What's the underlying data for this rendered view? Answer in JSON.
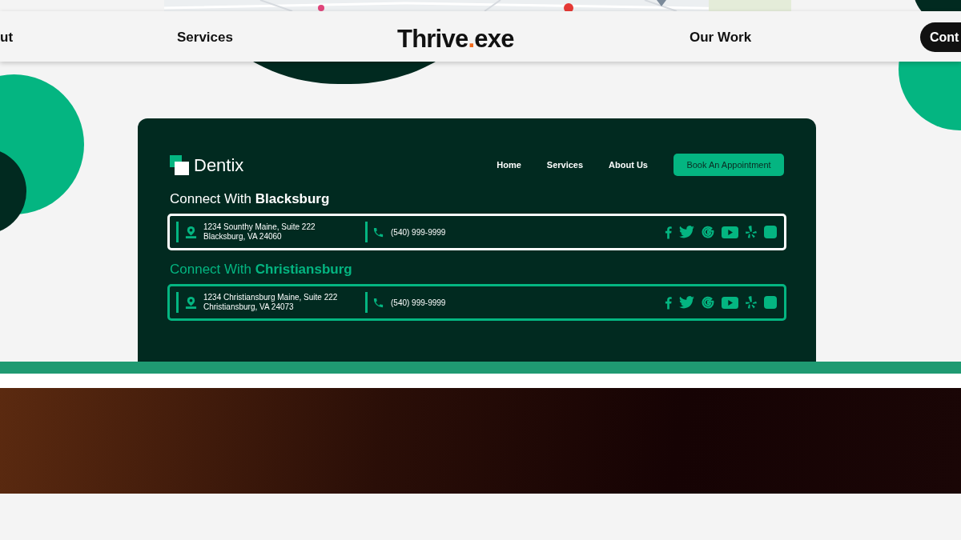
{
  "header": {
    "nav_left": [
      {
        "label": "ut"
      },
      {
        "label": "Services"
      }
    ],
    "logo": {
      "name": "Thrive",
      "dot": ".",
      "ext": "exe"
    },
    "nav_right": [
      {
        "label": "Our Work"
      }
    ],
    "cta": {
      "label": "Cont"
    }
  },
  "preview": {
    "brand": "Dentix",
    "nav": [
      {
        "label": "Home"
      },
      {
        "label": "Services"
      },
      {
        "label": "About Us"
      }
    ],
    "button": "Book An Appointment",
    "locations": [
      {
        "heading": "Connect With **Blacksburg**",
        "selected": true,
        "address": [
          "1234 Sounthy Maine, Suite 222",
          "Blacksburg, VA 24060"
        ],
        "phone": "(540) 999-9999"
      },
      {
        "heading": "Connect With **Christiansburg**",
        "selected": false,
        "address": [
          "1234 Christiansburg Maine, Suite 222",
          "Christiansburg, VA 24073"
        ],
        "phone": "(540) 999-9999"
      }
    ]
  }
}
